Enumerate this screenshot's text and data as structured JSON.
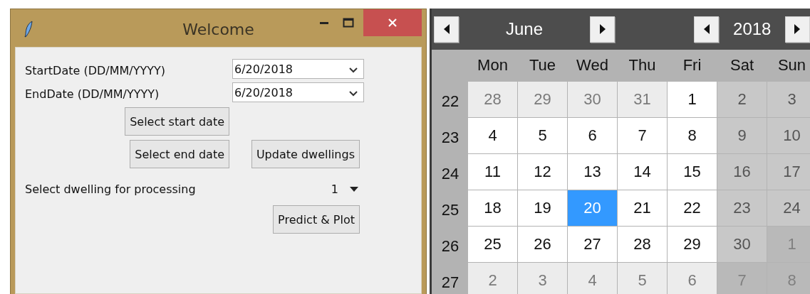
{
  "window": {
    "title": "Welcome"
  },
  "form": {
    "start_date": {
      "label": "StartDate (DD/MM/YYYY)",
      "value": "6/20/2018"
    },
    "end_date": {
      "label": "EndDate (DD/MM/YYYY)",
      "value": "6/20/2018"
    },
    "select_start_button": "Select start date",
    "select_end_button": "Select end date",
    "update_button": "Update dwellings",
    "dwelling": {
      "label": "Select dwelling for processing",
      "value": "1"
    },
    "predict_button": "Predict & Plot"
  },
  "calendar": {
    "month": "June",
    "year": "2018",
    "weekdays": [
      "Mon",
      "Tue",
      "Wed",
      "Thu",
      "Fri",
      "Sat",
      "Sun"
    ],
    "weeks": [
      {
        "number": "22",
        "days": [
          {
            "label": "28",
            "kind": "other",
            "selected": false
          },
          {
            "label": "29",
            "kind": "other",
            "selected": false
          },
          {
            "label": "30",
            "kind": "other",
            "selected": false
          },
          {
            "label": "31",
            "kind": "other",
            "selected": false
          },
          {
            "label": "1",
            "kind": "current",
            "selected": false
          },
          {
            "label": "2",
            "kind": "weekend",
            "selected": false
          },
          {
            "label": "3",
            "kind": "weekend",
            "selected": false
          }
        ]
      },
      {
        "number": "23",
        "days": [
          {
            "label": "4",
            "kind": "current",
            "selected": false
          },
          {
            "label": "5",
            "kind": "current",
            "selected": false
          },
          {
            "label": "6",
            "kind": "current",
            "selected": false
          },
          {
            "label": "7",
            "kind": "current",
            "selected": false
          },
          {
            "label": "8",
            "kind": "current",
            "selected": false
          },
          {
            "label": "9",
            "kind": "weekend",
            "selected": false
          },
          {
            "label": "10",
            "kind": "weekend",
            "selected": false
          }
        ]
      },
      {
        "number": "24",
        "days": [
          {
            "label": "11",
            "kind": "current",
            "selected": false
          },
          {
            "label": "12",
            "kind": "current",
            "selected": false
          },
          {
            "label": "13",
            "kind": "current",
            "selected": false
          },
          {
            "label": "14",
            "kind": "current",
            "selected": false
          },
          {
            "label": "15",
            "kind": "current",
            "selected": false
          },
          {
            "label": "16",
            "kind": "weekend",
            "selected": false
          },
          {
            "label": "17",
            "kind": "weekend",
            "selected": false
          }
        ]
      },
      {
        "number": "25",
        "days": [
          {
            "label": "18",
            "kind": "current",
            "selected": false
          },
          {
            "label": "19",
            "kind": "current",
            "selected": false
          },
          {
            "label": "20",
            "kind": "current",
            "selected": true
          },
          {
            "label": "21",
            "kind": "current",
            "selected": false
          },
          {
            "label": "22",
            "kind": "current",
            "selected": false
          },
          {
            "label": "23",
            "kind": "weekend",
            "selected": false
          },
          {
            "label": "24",
            "kind": "weekend",
            "selected": false
          }
        ]
      },
      {
        "number": "26",
        "days": [
          {
            "label": "25",
            "kind": "current",
            "selected": false
          },
          {
            "label": "26",
            "kind": "current",
            "selected": false
          },
          {
            "label": "27",
            "kind": "current",
            "selected": false
          },
          {
            "label": "28",
            "kind": "current",
            "selected": false
          },
          {
            "label": "29",
            "kind": "current",
            "selected": false
          },
          {
            "label": "30",
            "kind": "weekend",
            "selected": false
          },
          {
            "label": "1",
            "kind": "other_weekend",
            "selected": false
          }
        ]
      },
      {
        "number": "27",
        "days": [
          {
            "label": "2",
            "kind": "other",
            "selected": false
          },
          {
            "label": "3",
            "kind": "other",
            "selected": false
          },
          {
            "label": "4",
            "kind": "other",
            "selected": false
          },
          {
            "label": "5",
            "kind": "other",
            "selected": false
          },
          {
            "label": "6",
            "kind": "other",
            "selected": false
          },
          {
            "label": "7",
            "kind": "other_weekend",
            "selected": false
          },
          {
            "label": "8",
            "kind": "other_weekend",
            "selected": false
          }
        ]
      }
    ]
  }
}
